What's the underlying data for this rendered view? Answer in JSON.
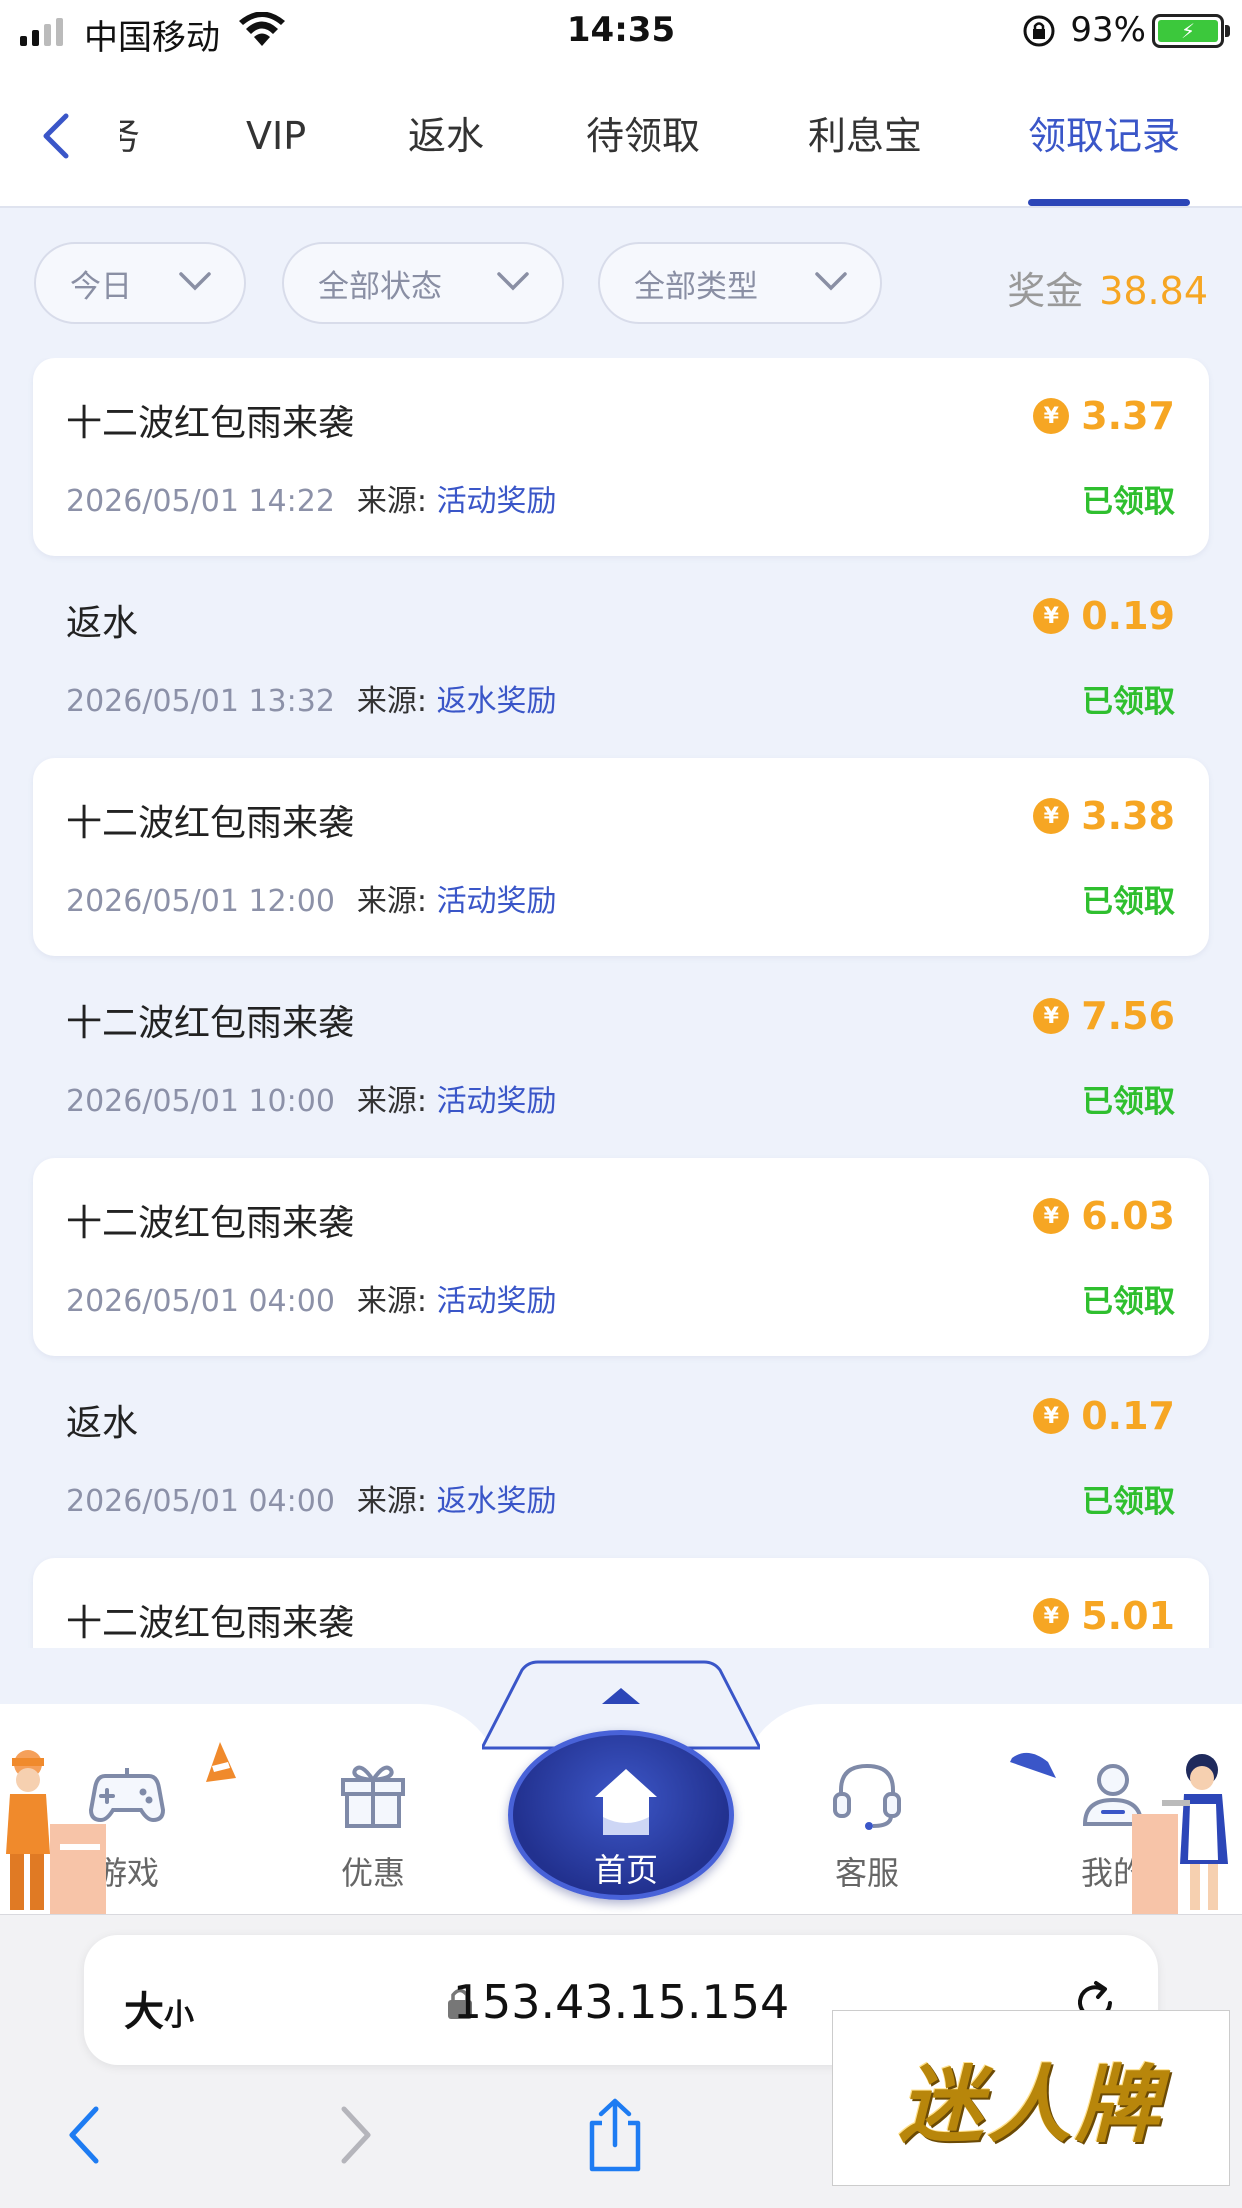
{
  "status_bar": {
    "carrier": "中国移动",
    "time": "14:35",
    "battery_percent": "93%"
  },
  "tabs": [
    {
      "label": "务"
    },
    {
      "label": "VIP"
    },
    {
      "label": "返水"
    },
    {
      "label": "待领取"
    },
    {
      "label": "利息宝"
    },
    {
      "label": "领取记录",
      "active": true
    }
  ],
  "filters": {
    "date": "今日",
    "status": "全部状态",
    "type": "全部类型",
    "bonus_label": "奖金",
    "bonus_value": "38.84"
  },
  "records": [
    {
      "title": "十二波红包雨来袭",
      "amount": "3.37",
      "time": "2026/05/01 14:22",
      "source_label": "来源:",
      "source": "活动奖励",
      "status": "已领取"
    },
    {
      "title": "返水",
      "amount": "0.19",
      "time": "2026/05/01 13:32",
      "source_label": "来源:",
      "source": "返水奖励",
      "status": "已领取"
    },
    {
      "title": "十二波红包雨来袭",
      "amount": "3.38",
      "time": "2026/05/01 12:00",
      "source_label": "来源:",
      "source": "活动奖励",
      "status": "已领取"
    },
    {
      "title": "十二波红包雨来袭",
      "amount": "7.56",
      "time": "2026/05/01 10:00",
      "source_label": "来源:",
      "source": "活动奖励",
      "status": "已领取"
    },
    {
      "title": "十二波红包雨来袭",
      "amount": "6.03",
      "time": "2026/05/01 04:00",
      "source_label": "来源:",
      "source": "活动奖励",
      "status": "已领取"
    },
    {
      "title": "返水",
      "amount": "0.17",
      "time": "2026/05/01 04:00",
      "source_label": "来源:",
      "source": "返水奖励",
      "status": "已领取"
    },
    {
      "title": "十二波红包雨来袭",
      "amount": "5.01",
      "time": "",
      "source_label": "",
      "source": "",
      "status": ""
    }
  ],
  "coin_symbol": "¥",
  "bottom_nav": {
    "games": "游戏",
    "promos": "优惠",
    "home": "首页",
    "service": "客服",
    "mine": "我的"
  },
  "browser": {
    "aa_label": "大",
    "aa_small": "小",
    "url": "153.43.15.154"
  },
  "watermark": "迷人牌",
  "colors": {
    "accent": "#3a56c8",
    "amount": "#f6a623",
    "claimed": "#2fbf2f"
  }
}
